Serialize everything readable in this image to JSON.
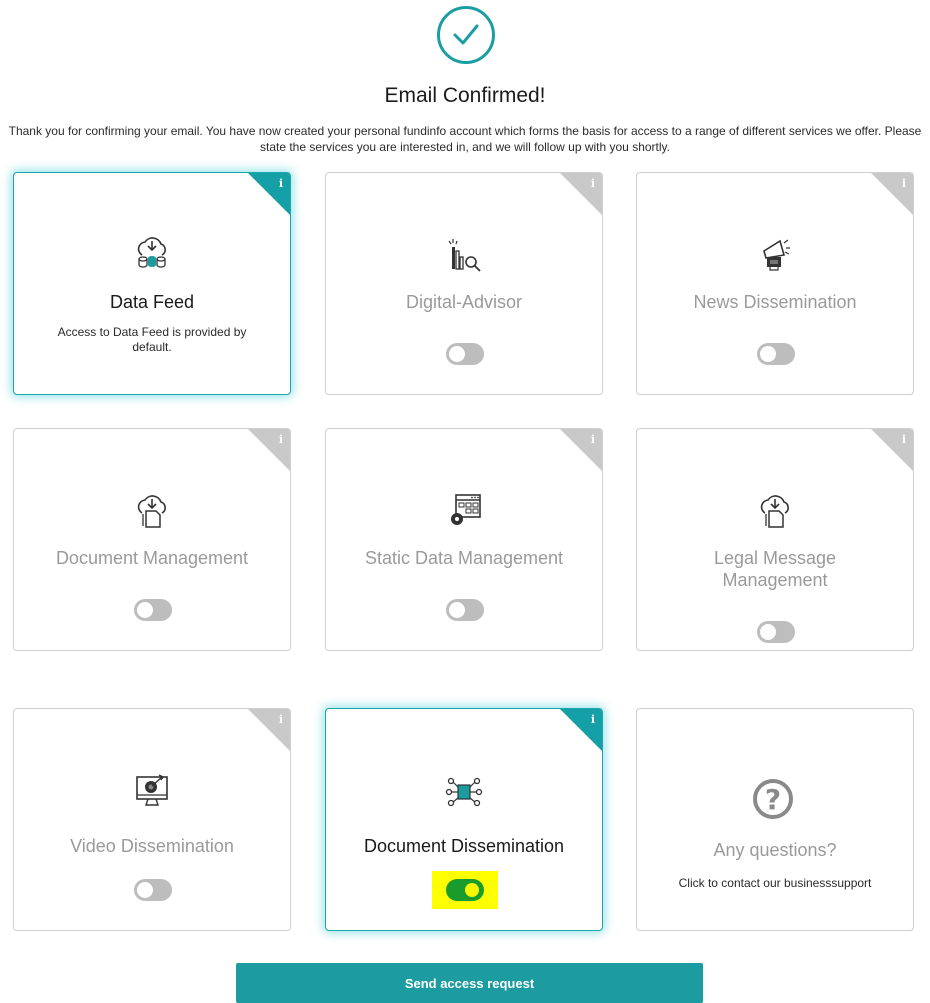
{
  "header": {
    "title": "Email Confirmed!",
    "intro": "Thank you for confirming your email. You have now created your personal fundinfo account which forms the basis for access to a range of different services we offer. Please state the services you are interested in, and we will follow up with you shortly."
  },
  "cards": [
    {
      "title": "Data Feed",
      "description": "Access to Data Feed is provided by default.",
      "icon": "cloud-database-icon",
      "active": true
    },
    {
      "title": "Digital-Advisor",
      "icon": "chart-search-icon",
      "toggle": false
    },
    {
      "title": "News Dissemination",
      "icon": "megaphone-icon",
      "toggle": false
    },
    {
      "title": "Document Management",
      "icon": "cloud-document-icon",
      "toggle": false
    },
    {
      "title": "Static Data Management",
      "icon": "browser-gear-icon",
      "toggle": false
    },
    {
      "title": "Legal Message Management",
      "icon": "cloud-document-icon",
      "toggle": false
    },
    {
      "title": "Video Dissemination",
      "icon": "monitor-target-icon",
      "toggle": false
    },
    {
      "title": "Document Dissemination",
      "icon": "document-network-icon",
      "toggle": true,
      "active": true
    },
    {
      "title": "Any questions?",
      "description": "Click to contact our businesssupport",
      "icon": "question-icon"
    }
  ],
  "info_label": "i",
  "question_mark": "?",
  "send_button": "Send access request",
  "colors": {
    "accent": "#1c9ba0",
    "toggle_on": "#1a9c2c",
    "highlight": "#ffff00"
  }
}
